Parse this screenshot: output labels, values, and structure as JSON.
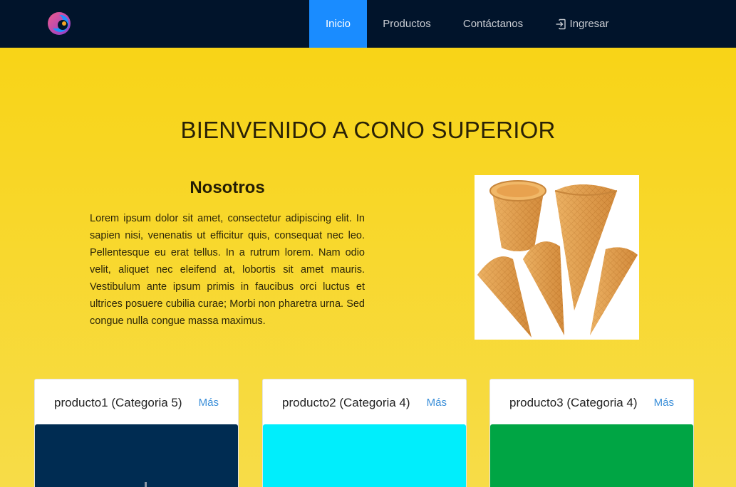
{
  "navbar": {
    "logo_alt": "logo",
    "items": [
      {
        "label": "Inicio",
        "active": true
      },
      {
        "label": "Productos",
        "active": false
      },
      {
        "label": "Contáctanos",
        "active": false
      },
      {
        "label": "Ingresar",
        "active": false,
        "icon": "login-icon"
      }
    ]
  },
  "hero": {
    "title": "BIENVENIDO A CONO SUPERIOR",
    "about_heading": "Nosotros",
    "about_text": "Lorem ipsum dolor sit amet, consectetur adipiscing elit. In sapien nisi, venenatis ut efficitur quis, consequat nec leo. Pellentesque eu erat tellus. In a rutrum lorem. Nam odio velit, aliquet nec eleifend at, lobortis sit amet mauris. Vestibulum ante ipsum primis in faucibus orci luctus et ultrices posuere cubilia curae; Morbi non pharetra urna. Sed congue nulla congue massa maximus.",
    "image": "ice-cream-cones"
  },
  "products": [
    {
      "title": "producto1 (Categoria 5)",
      "more_label": "Más",
      "color": "#002c52"
    },
    {
      "title": "producto2 (Categoria 4)",
      "more_label": "Más",
      "color": "#00eefc"
    },
    {
      "title": "producto3 (Categoria 4)",
      "more_label": "Más",
      "color": "#00a544"
    }
  ],
  "colors": {
    "navbar_bg": "#01142b",
    "active_nav": "#1a8cff",
    "page_bg": "#f8d417",
    "link": "#3b8fd9"
  }
}
